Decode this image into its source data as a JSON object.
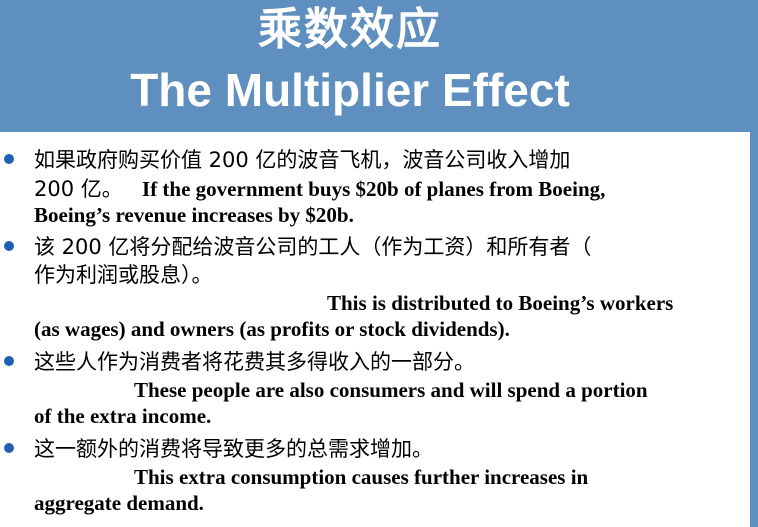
{
  "title": {
    "chinese": "乘数效应",
    "english": "The Multiplier Effect"
  },
  "bullets": [
    {
      "cn_line1": "如果政府购买价值 200 亿的波音飞机，波音公司收入增加",
      "line2_cn": "200 亿。",
      "line2_en": "If the government buys $20b of planes from Boeing,",
      "line3_en": "Boeing’s revenue increases by $20b."
    },
    {
      "cn_line1": "该 200 亿将分配给波音公司的工人（作为工资）和所有者（",
      "cn_line2": "作为利润或股息）。",
      "en_line1": "This is distributed to Boeing’s workers",
      "en_line2": "(as wages) and owners (as profits or stock dividends)."
    },
    {
      "cn_line1": "这些人作为消费者将花费其多得收入的一部分。",
      "en_line1": "These people are also consumers and will spend a portion",
      "en_line2": "of the extra income."
    },
    {
      "cn_line1": "这一额外的消费将导致更多的总需求增加。",
      "en_line1": "This extra consumption causes further increases in",
      "en_line2": "aggregate demand."
    }
  ],
  "colors": {
    "header_bg": "#5e8fbe",
    "bullet": "#1f5fb5",
    "title_text": "#ffffff",
    "body_text": "#000000"
  }
}
